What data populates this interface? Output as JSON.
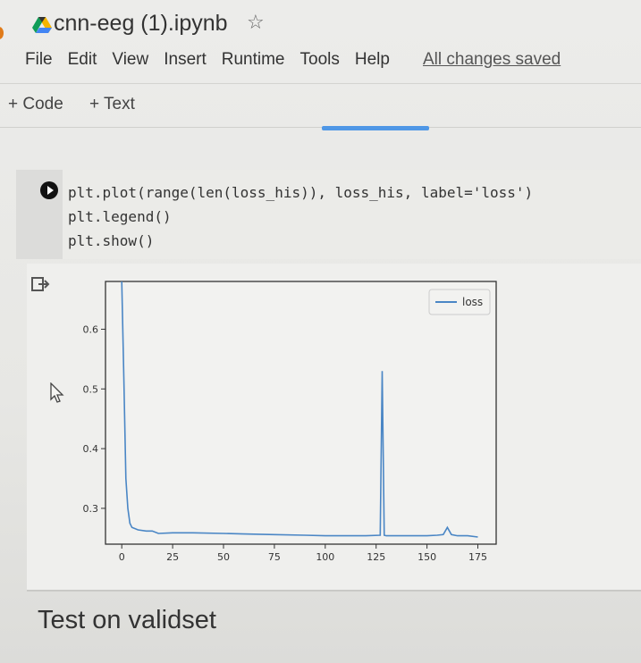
{
  "header": {
    "title": "cnn-eeg (1).ipynb",
    "star": "☆",
    "menu": [
      "File",
      "Edit",
      "View",
      "Insert",
      "Runtime",
      "Tools",
      "Help"
    ],
    "status": "All changes saved"
  },
  "toolbar": {
    "add_code": "+ Code",
    "add_text": "+ Text"
  },
  "cell": {
    "code_lines": [
      "plt.plot(range(len(loss_his)), loss_his, label='loss')",
      "plt.legend()",
      "plt.show()"
    ]
  },
  "chart_data": {
    "type": "line",
    "x_ticks": [
      0,
      25,
      50,
      75,
      100,
      125,
      150,
      175
    ],
    "y_ticks": [
      0.3,
      0.4,
      0.5,
      0.6
    ],
    "xlim": [
      -8,
      184
    ],
    "ylim": [
      0.24,
      0.68
    ],
    "legend": "top-right",
    "series": [
      {
        "name": "loss",
        "color": "#4a86c5",
        "x": [
          0,
          1,
          2,
          3,
          4,
          5,
          8,
          12,
          15,
          18,
          25,
          35,
          50,
          60,
          75,
          90,
          100,
          110,
          120,
          127,
          128,
          129,
          130,
          132,
          140,
          150,
          155,
          158,
          160,
          162,
          165,
          170,
          175
        ],
        "y": [
          0.68,
          0.52,
          0.35,
          0.3,
          0.275,
          0.268,
          0.264,
          0.262,
          0.262,
          0.258,
          0.259,
          0.259,
          0.258,
          0.257,
          0.256,
          0.255,
          0.254,
          0.254,
          0.254,
          0.255,
          0.53,
          0.255,
          0.254,
          0.254,
          0.254,
          0.254,
          0.255,
          0.256,
          0.268,
          0.256,
          0.254,
          0.254,
          0.252
        ]
      }
    ]
  },
  "section": {
    "title": "Test on validset"
  }
}
